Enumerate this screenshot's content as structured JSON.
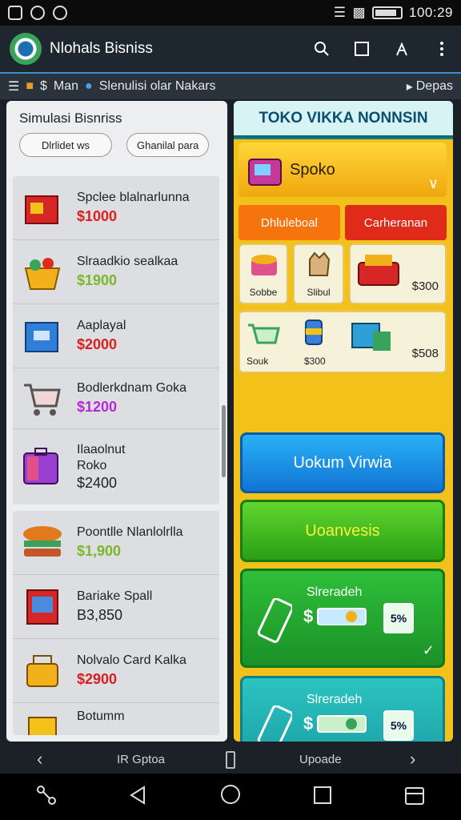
{
  "status_bar": {
    "time": "100:29"
  },
  "app": {
    "title": "Nlohals Bisniss"
  },
  "breadcrumb": {
    "item1": "Man",
    "item2": "Slenulisi olar Nakars",
    "right_link": "Depas"
  },
  "left_panel": {
    "title": "Simulasi Bisnriss",
    "filter_left": "Dlrlidet ws",
    "filter_right": "Ghanilal para",
    "items": [
      {
        "name": "Spclee blalnarlunna",
        "price": "$1000",
        "icon": "red-box-icon"
      },
      {
        "name": "Slraadkio sealkaa",
        "price": "$1900",
        "icon": "fruit-basket-icon"
      },
      {
        "name": "Aaplayal",
        "price": "$2000",
        "icon": "blue-box-icon"
      },
      {
        "name": "Bodlerkdnam Goka",
        "price": "$1200",
        "icon": "shopping-cart-icon"
      },
      {
        "name": "Ilaaolnut",
        "name2": "Roko",
        "price": "$2400",
        "icon": "suitcase-icon"
      },
      {
        "name": "Poontlle Nlanlolrlla",
        "price": "$1,900",
        "icon": "burger-icon"
      },
      {
        "name": "Bariake Spall",
        "price": "B3,850",
        "icon": "book-icon"
      },
      {
        "name": "Nolvalo Card Kalka",
        "price": "$2900",
        "icon": "cart-box-icon"
      },
      {
        "name": "Botumm",
        "price": "",
        "icon": "gift-icon"
      }
    ]
  },
  "right_panel": {
    "title": "TOKO VIKKA NONNSIN",
    "shop_label": "Spoko",
    "tab_left": "Dhluleboal",
    "tab_right": "Carheranan",
    "grid": {
      "c1": "Sobbe",
      "c2": "Slibul",
      "c3": "$300",
      "c4": "Souk",
      "c5": "$300",
      "c6": "$508"
    },
    "button_blue": "Uokum Virwia",
    "button_green": "Uoanvesis",
    "card1": {
      "title": "Slreradeh",
      "currency": "$",
      "bill": "5%"
    },
    "card2": {
      "title": "Slreradeh",
      "currency": "$",
      "bill": "5%"
    }
  },
  "footer": {
    "option": "IR Gptoa",
    "update": "Upoade"
  },
  "colors": {
    "accent_blue": "#1273d4",
    "accent_green": "#2a9f15",
    "price_red": "#d91f1f",
    "panel_yellow": "#f2c21a"
  }
}
